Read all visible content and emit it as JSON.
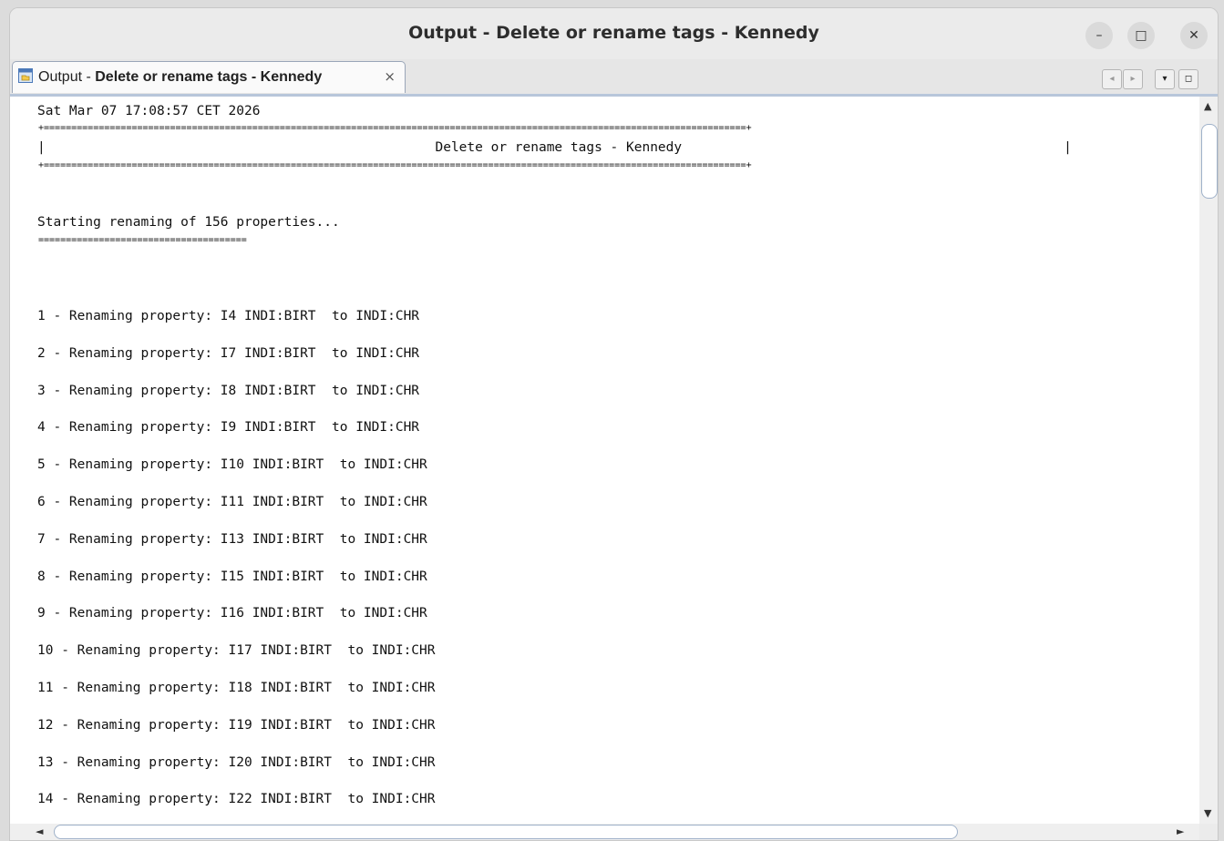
{
  "window": {
    "title": "Output - Delete or rename tags - Kennedy",
    "controls": {
      "minimize": "–",
      "maximize": "□",
      "close": "✕"
    }
  },
  "tab": {
    "prefix": "Output - ",
    "name": "Delete or rename tags - Kennedy",
    "close": "×",
    "icon": "output-window-icon"
  },
  "tab_controls": {
    "scroll_left": "◂",
    "scroll_right": "▸",
    "list": "▾",
    "restore": "◻"
  },
  "output": {
    "timestamp": "Sat Mar 07 17:08:57 CET 2026",
    "border_top": "+================================================================================================================================+",
    "header_line": "|                                                 Delete or rename tags - Kennedy                                                |",
    "border_bottom": "+================================================================================================================================+",
    "start_message": "Starting renaming of 156 properties...",
    "start_underline": "======================================",
    "entries": [
      "1 - Renaming property: I4 INDI:BIRT  to INDI:CHR",
      "2 - Renaming property: I7 INDI:BIRT  to INDI:CHR",
      "3 - Renaming property: I8 INDI:BIRT  to INDI:CHR",
      "4 - Renaming property: I9 INDI:BIRT  to INDI:CHR",
      "5 - Renaming property: I10 INDI:BIRT  to INDI:CHR",
      "6 - Renaming property: I11 INDI:BIRT  to INDI:CHR",
      "7 - Renaming property: I13 INDI:BIRT  to INDI:CHR",
      "8 - Renaming property: I15 INDI:BIRT  to INDI:CHR",
      "9 - Renaming property: I16 INDI:BIRT  to INDI:CHR",
      "10 - Renaming property: I17 INDI:BIRT  to INDI:CHR",
      "11 - Renaming property: I18 INDI:BIRT  to INDI:CHR",
      "12 - Renaming property: I19 INDI:BIRT  to INDI:CHR",
      "13 - Renaming property: I20 INDI:BIRT  to INDI:CHR",
      "14 - Renaming property: I22 INDI:BIRT  to INDI:CHR"
    ]
  },
  "scrollbars": {
    "up": "▲",
    "down": "▼",
    "left": "◄",
    "right": "►"
  }
}
